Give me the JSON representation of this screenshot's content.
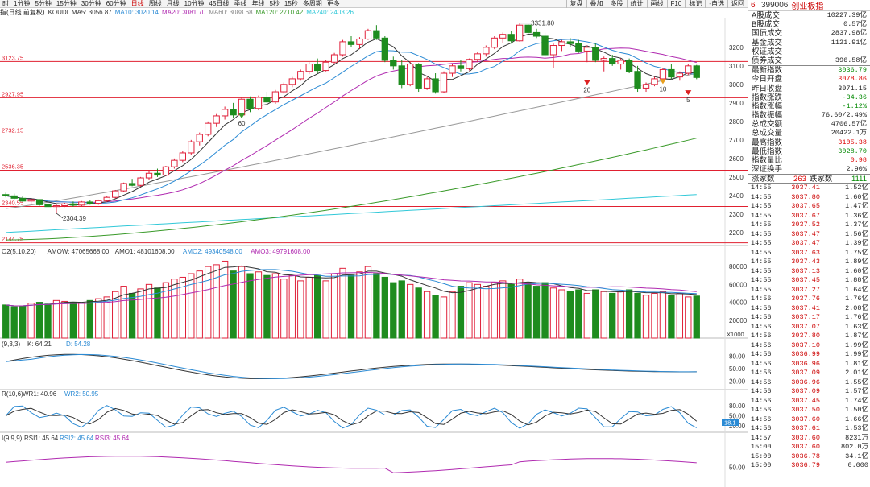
{
  "toolbar": {
    "left_items": [
      "时",
      "1分钟",
      "5分钟",
      "15分钟",
      "30分钟",
      "60分钟",
      "日线",
      "周线",
      "月线",
      "10分钟",
      "45日线",
      "季线",
      "年线",
      "5秒",
      "15秒",
      "多周期",
      "更多"
    ],
    "active_index": 6,
    "right_items": [
      "复盘",
      "叠加",
      "多股",
      "统计",
      "画线",
      "F10",
      "标记",
      "-自选",
      "返回"
    ]
  },
  "main_legend": {
    "prefix": "指(日线 前复权)",
    "koudi": "KOUDI",
    "ma5": "MA5: 3056.87",
    "ma10": "MA10: 3020.14",
    "ma20": "MA20: 3081.70",
    "ma60": "MA60: 3088.68",
    "ma120": "MA120: 2710.42",
    "ma240": "MA240: 2403.26"
  },
  "price_axis": [
    "3200",
    "3100",
    "3000",
    "2900",
    "2800",
    "2700",
    "2600",
    "2500",
    "2400",
    "2300",
    "2200"
  ],
  "hlines": [
    {
      "label": "3123.75",
      "price": 3123.75
    },
    {
      "label": "2927.95",
      "price": 2927.95
    },
    {
      "label": "2732.15",
      "price": 2732.15
    },
    {
      "label": "2536.35",
      "price": 2536.35
    },
    {
      "label": "2340.55",
      "price": 2340.55
    },
    {
      "label": "2144.75",
      "price": 2144.75
    }
  ],
  "annotations": {
    "high": "3331.80",
    "low": "2304.39",
    "mark_60": "60",
    "mark_20": "20",
    "mark_10": "10",
    "mark_5": "5"
  },
  "vol_legend": {
    "prefix": "O2(5,10,20)",
    "amow": "AMOW: 47065668.00",
    "amo1": "AMO1: 48101608.00",
    "amo2": "AMO2: 49340548.00",
    "amo3": "AMO3: 49791608.00",
    "axis": [
      "80000",
      "60000",
      "40000",
      "20000"
    ],
    "unit": "X1000"
  },
  "kdj_legend": {
    "prefix": "(9,3,3)",
    "k": "K: 64.21",
    "d": "D: 54.28",
    "axis": [
      "80.00",
      "50.00",
      "20.00"
    ]
  },
  "wr_legend": {
    "prefix": "R(10,6)",
    "wr1": "WR1: 40.96",
    "wr2": "WR2: 50.95",
    "axis": [
      "80.00",
      "50.00",
      "20.00"
    ],
    "marker": "18.1"
  },
  "rsi_legend": {
    "prefix": "I(9,9,9)",
    "rsi1": "RSI1: 45.64",
    "rsi2": "RSI2: 45.64",
    "rsi3": "RSI3: 45.64",
    "axis": [
      "50.00"
    ]
  },
  "panel": {
    "index_num": "6",
    "code": "399006",
    "name": "创业板指",
    "rows": [
      {
        "label": "A股成交",
        "value": "10227.39亿",
        "color": "black"
      },
      {
        "label": "B股成交",
        "value": "0.57亿",
        "color": "black"
      },
      {
        "label": "国债成交",
        "value": "2837.98亿",
        "color": "black"
      },
      {
        "label": "基金成交",
        "value": "1121.91亿",
        "color": "black"
      },
      {
        "label": "权证成交",
        "value": "",
        "color": "black"
      },
      {
        "label": "债券成交",
        "value": "396.58亿",
        "color": "black"
      }
    ],
    "rows2": [
      {
        "label": "最新指数",
        "value": "3036.79",
        "color": "green"
      },
      {
        "label": "今日开盘",
        "value": "3078.86",
        "color": "red"
      },
      {
        "label": "昨日收盘",
        "value": "3071.15",
        "color": "black"
      },
      {
        "label": "指数涨跌",
        "value": "-34.36",
        "color": "green"
      },
      {
        "label": "指数涨幅",
        "value": "-1.12%",
        "color": "green"
      },
      {
        "label": "指数振幅",
        "value": "76.60/2.49%",
        "color": "black"
      },
      {
        "label": "总成交额",
        "value": "4706.57亿",
        "color": "black"
      },
      {
        "label": "总成交量",
        "value": "20422.1万",
        "color": "black"
      },
      {
        "label": "最高指数",
        "value": "3105.38",
        "color": "red"
      },
      {
        "label": "最低指数",
        "value": "3028.70",
        "color": "green"
      },
      {
        "label": "指数量比",
        "value": "0.98",
        "color": "red"
      },
      {
        "label": "深证换手",
        "value": "2.90%",
        "color": "black"
      }
    ],
    "up_label": "涨家数",
    "up_count": "263",
    "down_label": "跌家数",
    "down_count": "1111",
    "ticks": [
      {
        "t": "14:55",
        "p": "3037.41",
        "v": "1.52亿"
      },
      {
        "t": "14:55",
        "p": "3037.80",
        "v": "1.60亿"
      },
      {
        "t": "14:55",
        "p": "3037.65",
        "v": "1.47亿"
      },
      {
        "t": "14:55",
        "p": "3037.67",
        "v": "1.36亿"
      },
      {
        "t": "14:55",
        "p": "3037.52",
        "v": "1.37亿"
      },
      {
        "t": "14:55",
        "p": "3037.47",
        "v": "1.56亿"
      },
      {
        "t": "14:55",
        "p": "3037.47",
        "v": "1.39亿"
      },
      {
        "t": "14:55",
        "p": "3037.63",
        "v": "1.75亿"
      },
      {
        "t": "14:55",
        "p": "3037.43",
        "v": "1.89亿"
      },
      {
        "t": "14:55",
        "p": "3037.13",
        "v": "1.60亿"
      },
      {
        "t": "14:55",
        "p": "3037.45",
        "v": "1.88亿"
      },
      {
        "t": "14:55",
        "p": "3037.27",
        "v": "1.64亿"
      },
      {
        "t": "14:56",
        "p": "3037.76",
        "v": "1.76亿"
      },
      {
        "t": "14:56",
        "p": "3037.41",
        "v": "2.08亿"
      },
      {
        "t": "14:56",
        "p": "3037.17",
        "v": "1.76亿"
      },
      {
        "t": "14:56",
        "p": "3037.07",
        "v": "1.63亿"
      },
      {
        "t": "14:56",
        "p": "3037.80",
        "v": "1.87亿"
      },
      {
        "t": "14:56",
        "p": "3037.10",
        "v": "1.99亿"
      },
      {
        "t": "14:56",
        "p": "3036.99",
        "v": "1.99亿"
      },
      {
        "t": "14:56",
        "p": "3036.96",
        "v": "1.81亿"
      },
      {
        "t": "14:56",
        "p": "3037.09",
        "v": "2.01亿"
      },
      {
        "t": "14:56",
        "p": "3036.96",
        "v": "1.55亿"
      },
      {
        "t": "14:56",
        "p": "3037.09",
        "v": "1.57亿"
      },
      {
        "t": "14:56",
        "p": "3037.45",
        "v": "1.74亿"
      },
      {
        "t": "14:56",
        "p": "3037.50",
        "v": "1.50亿"
      },
      {
        "t": "14:56",
        "p": "3037.60",
        "v": "1.66亿"
      },
      {
        "t": "14:56",
        "p": "3037.61",
        "v": "1.53亿"
      },
      {
        "t": "14:57",
        "p": "3037.60",
        "v": "8231万"
      },
      {
        "t": "15:00",
        "p": "3037.60",
        "v": "802.0万"
      },
      {
        "t": "15:00",
        "p": "3036.78",
        "v": "34.1亿"
      },
      {
        "t": "15:00",
        "p": "3036.79",
        "v": "0.000"
      }
    ]
  },
  "colors": {
    "up": "#e0203a",
    "down": "#1e8c1e",
    "hline": "#e02030",
    "ma5": "#333333",
    "ma10": "#2a8ad4",
    "ma20": "#b02ab0",
    "ma60": "#999999",
    "ma120": "#3a9a2a",
    "ma240": "#30c8d8"
  },
  "chart_data": {
    "type": "candlestick",
    "ohlc": [
      [
        2405,
        2415,
        2390,
        2398
      ],
      [
        2398,
        2410,
        2380,
        2385
      ],
      [
        2385,
        2395,
        2365,
        2370
      ],
      [
        2370,
        2385,
        2355,
        2378
      ],
      [
        2378,
        2380,
        2345,
        2350
      ],
      [
        2350,
        2360,
        2330,
        2340
      ],
      [
        2340,
        2352,
        2304,
        2345
      ],
      [
        2345,
        2360,
        2338,
        2355
      ],
      [
        2355,
        2368,
        2340,
        2348
      ],
      [
        2348,
        2370,
        2342,
        2365
      ],
      [
        2365,
        2375,
        2350,
        2358
      ],
      [
        2358,
        2378,
        2350,
        2372
      ],
      [
        2372,
        2395,
        2365,
        2390
      ],
      [
        2390,
        2430,
        2385,
        2425
      ],
      [
        2425,
        2470,
        2418,
        2465
      ],
      [
        2465,
        2490,
        2450,
        2455
      ],
      [
        2455,
        2500,
        2448,
        2495
      ],
      [
        2495,
        2530,
        2485,
        2520
      ],
      [
        2520,
        2545,
        2500,
        2510
      ],
      [
        2510,
        2560,
        2505,
        2555
      ],
      [
        2555,
        2600,
        2545,
        2590
      ],
      [
        2590,
        2640,
        2580,
        2630
      ],
      [
        2630,
        2700,
        2620,
        2690
      ],
      [
        2690,
        2740,
        2670,
        2730
      ],
      [
        2730,
        2800,
        2720,
        2790
      ],
      [
        2790,
        2840,
        2770,
        2830
      ],
      [
        2830,
        2880,
        2810,
        2865
      ],
      [
        2865,
        2900,
        2820,
        2835
      ],
      [
        2835,
        2930,
        2830,
        2920
      ],
      [
        2920,
        2935,
        2850,
        2870
      ],
      [
        2870,
        2940,
        2860,
        2930
      ],
      [
        2930,
        2960,
        2900,
        2905
      ],
      [
        2905,
        2970,
        2895,
        2960
      ],
      [
        2960,
        3010,
        2950,
        3000
      ],
      [
        3000,
        3040,
        2985,
        3030
      ],
      [
        3030,
        3080,
        3020,
        3070
      ],
      [
        3070,
        3120,
        3055,
        3110
      ],
      [
        3110,
        3140,
        3060,
        3075
      ],
      [
        3075,
        3130,
        3070,
        3120
      ],
      [
        3120,
        3170,
        3110,
        3160
      ],
      [
        3160,
        3240,
        3150,
        3230
      ],
      [
        3230,
        3260,
        3200,
        3215
      ],
      [
        3215,
        3255,
        3190,
        3245
      ],
      [
        3245,
        3300,
        3240,
        3290
      ],
      [
        3290,
        3320,
        3240,
        3250
      ],
      [
        3250,
        3260,
        3120,
        3130
      ],
      [
        3130,
        3150,
        3080,
        3100
      ],
      [
        3100,
        3130,
        2980,
        3000
      ],
      [
        3000,
        3120,
        2990,
        3110
      ],
      [
        3110,
        3115,
        2960,
        2980
      ],
      [
        2980,
        3040,
        2970,
        3030
      ],
      [
        3030,
        3060,
        2950,
        2960
      ],
      [
        2960,
        3070,
        2955,
        3060
      ],
      [
        3060,
        3110,
        3040,
        3100
      ],
      [
        3100,
        3130,
        3070,
        3085
      ],
      [
        3085,
        3140,
        3075,
        3135
      ],
      [
        3135,
        3175,
        3120,
        3165
      ],
      [
        3165,
        3210,
        3150,
        3200
      ],
      [
        3200,
        3260,
        3190,
        3250
      ],
      [
        3250,
        3280,
        3225,
        3270
      ],
      [
        3270,
        3290,
        3220,
        3235
      ],
      [
        3235,
        3331,
        3230,
        3320
      ],
      [
        3320,
        3325,
        3270,
        3280
      ],
      [
        3280,
        3300,
        3250,
        3260
      ],
      [
        3260,
        3280,
        3140,
        3160
      ],
      [
        3160,
        3220,
        3090,
        3210
      ],
      [
        3210,
        3240,
        3180,
        3230
      ],
      [
        3230,
        3250,
        3200,
        3220
      ],
      [
        3220,
        3240,
        3170,
        3180
      ],
      [
        3180,
        3210,
        3120,
        3200
      ],
      [
        3200,
        3220,
        3120,
        3130
      ],
      [
        3130,
        3150,
        3070,
        3140
      ],
      [
        3140,
        3160,
        3100,
        3110
      ],
      [
        3110,
        3140,
        3080,
        3130
      ],
      [
        3130,
        3140,
        3060,
        3070
      ],
      [
        3070,
        3100,
        2960,
        2980
      ],
      [
        2980,
        3010,
        2960,
        3000
      ],
      [
        3000,
        3040,
        2990,
        3030
      ],
      [
        3030,
        3090,
        3020,
        3080
      ],
      [
        3080,
        3110,
        3030,
        3040
      ],
      [
        3040,
        3070,
        3020,
        3060
      ],
      [
        3060,
        3110,
        3050,
        3100
      ],
      [
        3100,
        3105,
        3028,
        3037
      ]
    ],
    "volume": [
      37000,
      35000,
      36000,
      39000,
      40000,
      38000,
      42000,
      41000,
      40000,
      39000,
      42000,
      44000,
      46000,
      52000,
      58000,
      50000,
      55000,
      60000,
      56000,
      62000,
      66000,
      68000,
      72000,
      75000,
      80000,
      82000,
      86000,
      75000,
      80000,
      72000,
      74000,
      70000,
      72000,
      66000,
      70000,
      64000,
      68000,
      70000,
      64000,
      72000,
      78000,
      70000,
      74000,
      80000,
      72000,
      68000,
      62000,
      64000,
      60000,
      56000,
      52000,
      48000,
      46000,
      52000,
      58000,
      62000,
      60000,
      58000,
      62000,
      64000,
      60000,
      66000,
      62000,
      58000,
      62000,
      56000,
      54000,
      52000,
      54000,
      50000,
      54000,
      52000,
      50000,
      52000,
      54000,
      50000,
      48000,
      50000,
      52000,
      48000,
      50000,
      46000,
      47000
    ]
  }
}
